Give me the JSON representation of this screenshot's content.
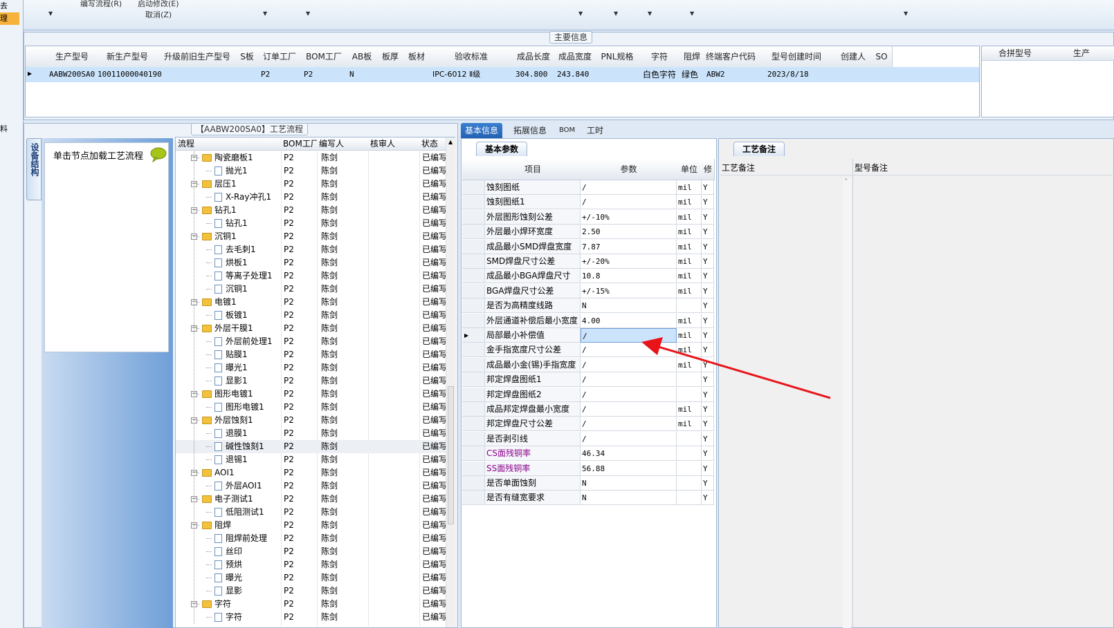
{
  "menu": {
    "left_labels": [
      "去",
      "理",
      "料"
    ],
    "edit_flow": "编写流程(R)",
    "start_modify": "启动修改(E)",
    "cancel": "取消(Z)"
  },
  "main_info": {
    "title": "主要信息",
    "columns": [
      "生产型号",
      "新生产型号",
      "升级前旧生产型号",
      "S板",
      "订单工厂",
      "BOM工厂",
      "AB板",
      "板厚",
      "板材",
      "验收标准",
      "成品长度",
      "成品宽度",
      "PNL规格",
      "字符",
      "阻焊",
      "终端客户代码",
      "型号创建时间",
      "创建人",
      "SO"
    ],
    "row": [
      "AABW200SA0",
      "10011000040190",
      "",
      "",
      "P2",
      "P2",
      "N",
      "",
      "",
      "IPC-6012 Ⅱ级",
      "304.800",
      "243.840",
      "",
      "白色字符",
      "绿色",
      "ABW2",
      "2023/8/18",
      "",
      ""
    ],
    "side_columns": [
      "合拼型号",
      "生产"
    ]
  },
  "process": {
    "title": "【AABW200SA0】工艺流程",
    "side_tab": "设备结构",
    "load_hint": "单击节点加载工艺流程",
    "columns": [
      "流程",
      "BOM工厂",
      "编写人",
      "核审人",
      "状态"
    ],
    "rows": [
      {
        "name": "陶瓷磨板1",
        "type": "folder",
        "factory": "P2",
        "author": "陈剑",
        "status": "已编写"
      },
      {
        "name": "抛光1",
        "type": "file",
        "factory": "P2",
        "author": "陈剑",
        "status": "已编写"
      },
      {
        "name": "层压1",
        "type": "folder",
        "factory": "P2",
        "author": "陈剑",
        "status": "已编写"
      },
      {
        "name": "X-Ray冲孔1",
        "type": "file",
        "factory": "P2",
        "author": "陈剑",
        "status": "已编写"
      },
      {
        "name": "钻孔1",
        "type": "folder",
        "factory": "P2",
        "author": "陈剑",
        "status": "已编写"
      },
      {
        "name": "钻孔1",
        "type": "file",
        "factory": "P2",
        "author": "陈剑",
        "status": "已编写"
      },
      {
        "name": "沉铜1",
        "type": "folder",
        "factory": "P2",
        "author": "陈剑",
        "status": "已编写"
      },
      {
        "name": "去毛刺1",
        "type": "file",
        "factory": "P2",
        "author": "陈剑",
        "status": "已编写"
      },
      {
        "name": "烘板1",
        "type": "file",
        "factory": "P2",
        "author": "陈剑",
        "status": "已编写"
      },
      {
        "name": "等离子处理1",
        "type": "file",
        "factory": "P2",
        "author": "陈剑",
        "status": "已编写"
      },
      {
        "name": "沉铜1",
        "type": "file",
        "factory": "P2",
        "author": "陈剑",
        "status": "已编写"
      },
      {
        "name": "电镀1",
        "type": "folder",
        "factory": "P2",
        "author": "陈剑",
        "status": "已编写"
      },
      {
        "name": "板镀1",
        "type": "file",
        "factory": "P2",
        "author": "陈剑",
        "status": "已编写"
      },
      {
        "name": "外层干膜1",
        "type": "folder",
        "factory": "P2",
        "author": "陈剑",
        "status": "已编写"
      },
      {
        "name": "外层前处理1",
        "type": "file",
        "factory": "P2",
        "author": "陈剑",
        "status": "已编写"
      },
      {
        "name": "贴膜1",
        "type": "file",
        "factory": "P2",
        "author": "陈剑",
        "status": "已编写"
      },
      {
        "name": "曝光1",
        "type": "file",
        "factory": "P2",
        "author": "陈剑",
        "status": "已编写"
      },
      {
        "name": "显影1",
        "type": "file",
        "factory": "P2",
        "author": "陈剑",
        "status": "已编写"
      },
      {
        "name": "图形电镀1",
        "type": "folder",
        "factory": "P2",
        "author": "陈剑",
        "status": "已编写"
      },
      {
        "name": "图形电镀1",
        "type": "file",
        "factory": "P2",
        "author": "陈剑",
        "status": "已编写"
      },
      {
        "name": "外层蚀刻1",
        "type": "folder",
        "factory": "P2",
        "author": "陈剑",
        "status": "已编写"
      },
      {
        "name": "退膜1",
        "type": "file",
        "factory": "P2",
        "author": "陈剑",
        "status": "已编写"
      },
      {
        "name": "碱性蚀刻1",
        "type": "file",
        "factory": "P2",
        "author": "陈剑",
        "status": "已编写"
      },
      {
        "name": "退锡1",
        "type": "file",
        "factory": "P2",
        "author": "陈剑",
        "status": "已编写"
      },
      {
        "name": "AOI1",
        "type": "folder",
        "factory": "P2",
        "author": "陈剑",
        "status": "已编写"
      },
      {
        "name": "外层AOI1",
        "type": "file",
        "factory": "P2",
        "author": "陈剑",
        "status": "已编写"
      },
      {
        "name": "电子测试1",
        "type": "folder",
        "factory": "P2",
        "author": "陈剑",
        "status": "已编写"
      },
      {
        "name": "低阻测试1",
        "type": "file",
        "factory": "P2",
        "author": "陈剑",
        "status": "已编写"
      },
      {
        "name": "阻焊",
        "type": "folder",
        "factory": "P2",
        "author": "陈剑",
        "status": "已编写"
      },
      {
        "name": "阻焊前处理",
        "type": "file",
        "factory": "P2",
        "author": "陈剑",
        "status": "已编写"
      },
      {
        "name": "丝印",
        "type": "file",
        "factory": "P2",
        "author": "陈剑",
        "status": "已编写"
      },
      {
        "name": "预烘",
        "type": "file",
        "factory": "P2",
        "author": "陈剑",
        "status": "已编写"
      },
      {
        "name": "曝光",
        "type": "file",
        "factory": "P2",
        "author": "陈剑",
        "status": "已编写"
      },
      {
        "name": "显影",
        "type": "file",
        "factory": "P2",
        "author": "陈剑",
        "status": "已编写"
      },
      {
        "name": "字符",
        "type": "folder",
        "factory": "P2",
        "author": "陈剑",
        "status": "已编写"
      },
      {
        "name": "字符",
        "type": "file",
        "factory": "P2",
        "author": "陈剑",
        "status": "已编写"
      }
    ]
  },
  "tabs": [
    "基本信息",
    "拓展信息",
    "BOM",
    "工时"
  ],
  "params": {
    "title": "基本参数",
    "columns": [
      "项目",
      "参数",
      "单位",
      "修"
    ],
    "rows": [
      {
        "item": "蚀刻图纸",
        "value": "/",
        "unit": "mil",
        "flag": "Y"
      },
      {
        "item": "蚀刻图纸1",
        "value": "/",
        "unit": "mil",
        "flag": "Y"
      },
      {
        "item": "外层图形蚀刻公差",
        "value": "+/-10%",
        "unit": "mil",
        "flag": "Y"
      },
      {
        "item": "外层最小焊环宽度",
        "value": "2.50",
        "unit": "mil",
        "flag": "Y"
      },
      {
        "item": "成品最小SMD焊盘宽度",
        "value": "7.87",
        "unit": "mil",
        "flag": "Y"
      },
      {
        "item": "SMD焊盘尺寸公差",
        "value": "+/-20%",
        "unit": "mil",
        "flag": "Y"
      },
      {
        "item": "成品最小BGA焊盘尺寸",
        "value": "10.8",
        "unit": "mil",
        "flag": "Y"
      },
      {
        "item": "BGA焊盘尺寸公差",
        "value": "+/-15%",
        "unit": "mil",
        "flag": "Y"
      },
      {
        "item": "是否为高精度线路",
        "value": "N",
        "unit": "",
        "flag": "Y"
      },
      {
        "item": "外层通道补偿后最小宽度",
        "value": "4.00",
        "unit": "mil",
        "flag": "Y"
      },
      {
        "item": "局部最小补偿值",
        "value": "/",
        "unit": "mil",
        "flag": "Y"
      },
      {
        "item": "金手指宽度尺寸公差",
        "value": "/",
        "unit": "mil",
        "flag": "Y"
      },
      {
        "item": "成品最小金(锡)手指宽度",
        "value": "/",
        "unit": "mil",
        "flag": "Y"
      },
      {
        "item": "邦定焊盘图纸1",
        "value": "/",
        "unit": "",
        "flag": "Y"
      },
      {
        "item": "邦定焊盘图纸2",
        "value": "/",
        "unit": "",
        "flag": "Y"
      },
      {
        "item": "成品邦定焊盘最小宽度",
        "value": "/",
        "unit": "mil",
        "flag": "Y"
      },
      {
        "item": "邦定焊盘尺寸公差",
        "value": "/",
        "unit": "mil",
        "flag": "Y"
      },
      {
        "item": "是否剥引线",
        "value": "/",
        "unit": "",
        "flag": "Y"
      },
      {
        "item": "CS面残铜率",
        "value": "46.34",
        "unit": "",
        "flag": "Y"
      },
      {
        "item": "SS面残铜率",
        "value": "56.88",
        "unit": "",
        "flag": "Y"
      },
      {
        "item": "是否单面蚀刻",
        "value": "N",
        "unit": "",
        "flag": "Y"
      },
      {
        "item": "是否有缝宽要求",
        "value": "N",
        "unit": "",
        "flag": "Y"
      }
    ],
    "selected_index": 10,
    "highlight_color": "#8b008b"
  },
  "notes": {
    "title": "工艺备注",
    "columns": [
      "工艺备注",
      "型号备注"
    ]
  },
  "colors": {
    "accent": "#2461b3",
    "selection": "#cce4fb",
    "arrow": "#e8141a"
  }
}
